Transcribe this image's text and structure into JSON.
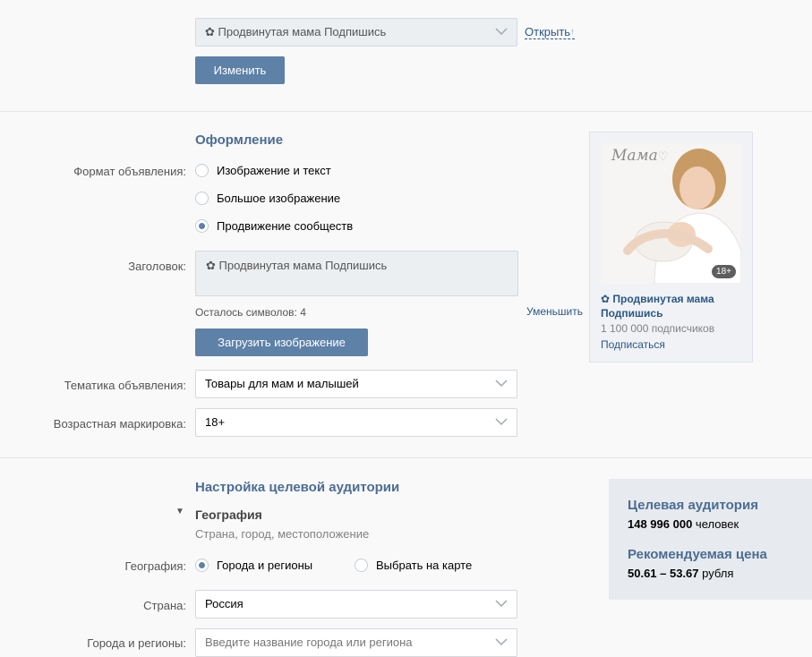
{
  "top": {
    "community_select": "✿ Продвинутая мама  Подпишись",
    "open_link": "Открыть",
    "change_button": "Изменить"
  },
  "design": {
    "title": "Оформление",
    "format_label": "Формат объявления:",
    "formats": [
      {
        "label": "Изображение и текст",
        "selected": false
      },
      {
        "label": "Большое изображение",
        "selected": false
      },
      {
        "label": "Продвижение сообществ",
        "selected": true
      }
    ],
    "heading_label": "Заголовок:",
    "heading_value": "✿ Продвинутая мама  Подпишись",
    "chars_left": "Осталось символов: 4",
    "shrink_link": "Уменьшить",
    "upload_button": "Загрузить изображение",
    "topic_label": "Тематика объявления:",
    "topic_value": "Товары для мам и малышей",
    "age_label": "Возрастная маркировка:",
    "age_value": "18+"
  },
  "preview": {
    "logo_text": "Мама",
    "age_badge": "18+",
    "title": "✿ Продвинутая мама Подпишись",
    "subscribers": "1 100 000 подписчиков",
    "subscribe_link": "Подписаться"
  },
  "audience": {
    "title": "Настройка целевой аудитории",
    "geo_header": "География",
    "geo_desc": "Страна, город, местоположение",
    "geo_label": "География:",
    "geo_options": [
      {
        "label": "Города и регионы",
        "selected": true
      },
      {
        "label": "Выбрать на карте",
        "selected": false
      }
    ],
    "country_label": "Страна:",
    "country_value": "Россия",
    "cities_label": "Города и регионы:",
    "cities_placeholder": "Введите название города или региона"
  },
  "target_panel": {
    "aud_title": "Целевая аудитория",
    "aud_count": "148 996 000",
    "aud_unit": "человек",
    "price_title": "Рекомендуемая цена",
    "price_range": "50.61 – 53.67",
    "price_unit": "рубля"
  },
  "colors": {
    "accent": "#5e81a8",
    "title": "#4c6d93",
    "link": "#2a5885"
  }
}
